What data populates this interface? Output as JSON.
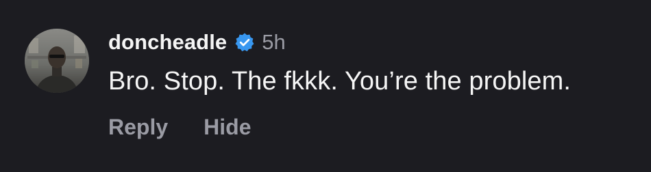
{
  "comment": {
    "author": {
      "username": "doncheadle",
      "verified_icon": "verified-badge-icon",
      "badge_color": "#3897f0"
    },
    "timestamp": "5h",
    "text": "Bro. Stop. The fkkk. You’re the problem.",
    "actions": {
      "reply_label": "Reply",
      "hide_label": "Hide"
    }
  },
  "colors": {
    "background": "#1c1c21",
    "primary_text": "#f5f5f5",
    "secondary_text": "#9a9ba4"
  }
}
